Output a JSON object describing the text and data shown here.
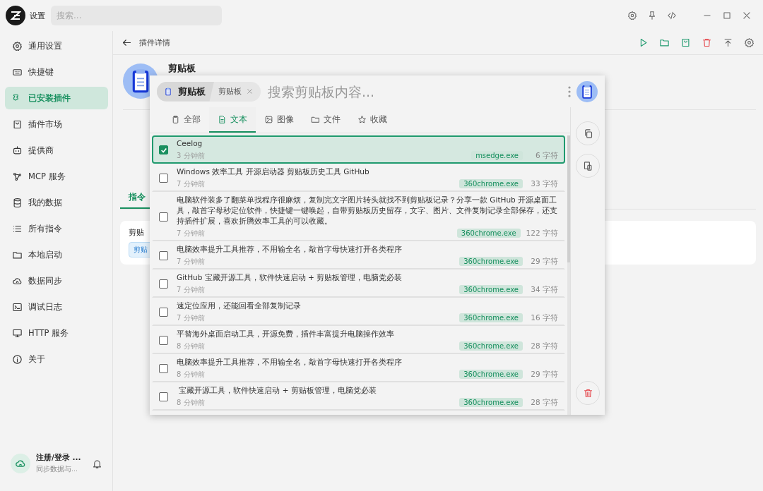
{
  "titlebar": {
    "app_name": "设置",
    "search": {
      "placeholder": "搜索..."
    }
  },
  "sidebar": {
    "items": [
      {
        "label": "通用设置",
        "selected": false
      },
      {
        "label": "快捷键",
        "selected": false
      },
      {
        "label": "已安装插件",
        "selected": true
      },
      {
        "label": "插件市场",
        "selected": false
      },
      {
        "label": "提供商",
        "selected": false
      },
      {
        "label": "MCP 服务",
        "selected": false
      },
      {
        "label": "我的数据",
        "selected": false
      },
      {
        "label": "所有指令",
        "selected": false
      },
      {
        "label": "本地启动",
        "selected": false
      },
      {
        "label": "数据同步",
        "selected": false
      },
      {
        "label": "调试日志",
        "selected": false
      },
      {
        "label": "HTTP 服务",
        "selected": false
      },
      {
        "label": "关于",
        "selected": false
      }
    ],
    "account": {
      "title": "注册/登录 ...",
      "subtitle": "同步数据与..."
    }
  },
  "page": {
    "title": "插件详情",
    "plugin_name": "剪贴板",
    "tabs": [
      {
        "label": "指令",
        "selected": true
      }
    ],
    "command_card": {
      "title": "剪贴",
      "chip": "剪贴"
    }
  },
  "popup": {
    "pill": {
      "label": "剪贴板",
      "tag": "剪贴板"
    },
    "search": {
      "placeholder": "搜索剪贴板内容..."
    },
    "tabs": [
      {
        "label": "全部",
        "selected": false
      },
      {
        "label": "文本",
        "selected": true
      },
      {
        "label": "图像",
        "selected": false
      },
      {
        "label": "文件",
        "selected": false
      },
      {
        "label": "收藏",
        "selected": false
      }
    ],
    "items": [
      {
        "text": "Ceelog",
        "time": "3 分钟前",
        "source": "msedge.exe",
        "count": "6 字符",
        "checked": true
      },
      {
        "text": "Windows 效率工具 开源启动器 剪贴板历史工具 GitHub",
        "time": "7 分钟前",
        "source": "360chrome.exe",
        "count": "33 字符",
        "checked": false
      },
      {
        "text": "电脑软件装多了翻菜单找程序很麻烦，复制完文字图片转头就找不到剪贴板记录？分享一款 GitHub 开源桌面工具，敲首字母秒定位软件，快捷键一键唤起，自带剪贴板历史留存，文字、图片、文件复制记录全部保存，还支持插件扩展，喜欢折腾效率工具的可以收藏。",
        "time": "7 分钟前",
        "source": "360chrome.exe",
        "count": "122 字符",
        "checked": false
      },
      {
        "text": "电脑效率提升工具推荐，不用输全名，敲首字母快速打开各类程序",
        "time": "7 分钟前",
        "source": "360chrome.exe",
        "count": "29 字符",
        "checked": false
      },
      {
        "text": "GitHub 宝藏开源工具，软件快速启动 + 剪贴板管理，电脑党必装",
        "time": "7 分钟前",
        "source": "360chrome.exe",
        "count": "34 字符",
        "checked": false
      },
      {
        "text": "速定位应用，还能回看全部复制记录",
        "time": "7 分钟前",
        "source": "360chrome.exe",
        "count": "16 字符",
        "checked": false
      },
      {
        "text": "平替海外桌面启动工具，开源免费，插件丰富提升电脑操作效率",
        "time": "8 分钟前",
        "source": "360chrome.exe",
        "count": "28 字符",
        "checked": false
      },
      {
        "text": "电脑效率提升工具推荐，不用输全名，敲首字母快速打开各类程序",
        "time": "8 分钟前",
        "source": "360chrome.exe",
        "count": "29 字符",
        "checked": false
      },
      {
        "text": " 宝藏开源工具，软件快速启动 + 剪贴板管理，电脑党必装",
        "time": "8 分钟前",
        "source": "360chrome.exe",
        "count": "28 字符",
        "checked": false
      }
    ]
  }
}
